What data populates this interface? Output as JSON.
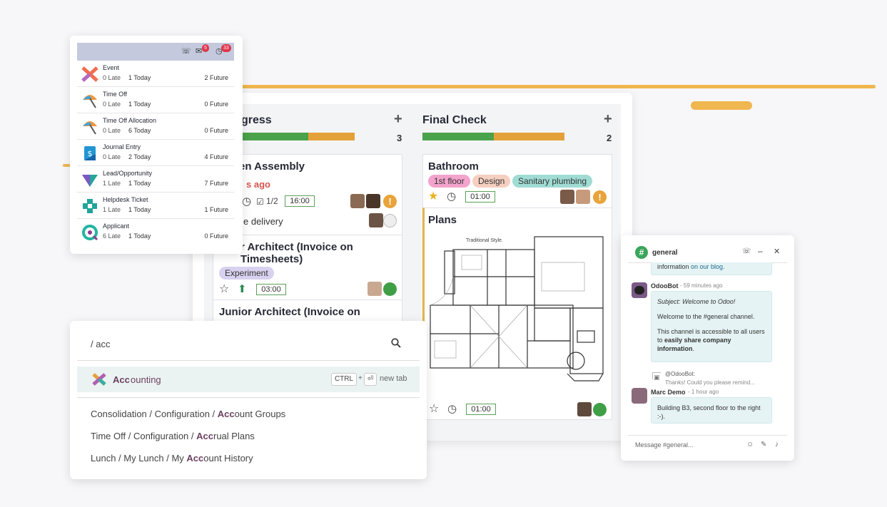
{
  "colors": {
    "accent": "#875a7b",
    "progress_green": "#4aa24a",
    "progress_orange": "#e4a13a",
    "stroke_orange": "#f0b64f",
    "chat_bubble": "#e5f3f4",
    "late_red": "#d9534f"
  },
  "kanban": {
    "columns": [
      {
        "title": "gress",
        "count": "3"
      },
      {
        "title": "Final Check",
        "count": "2"
      }
    ],
    "cards": [
      {
        "title": "en Assembly",
        "late_text": "s ago",
        "checklist": "1/2",
        "time": "16:00",
        "activity": "e delivery"
      },
      {
        "title": "r Architect (Invoice on Timesheets)",
        "tag": "Experiment",
        "time": "03:00"
      },
      {
        "title": "Junior Architect (Invoice on"
      },
      {
        "title": "Bathroom",
        "tags": [
          "1st floor",
          "Design",
          "Sanitary plumbing"
        ],
        "time": "01:00"
      },
      {
        "title": "Plans",
        "floorplan_caption": "Traditional Style.",
        "time": "01:00"
      }
    ]
  },
  "activity": {
    "badges": {
      "chat": "5",
      "clock": "33"
    },
    "items": [
      {
        "name": "Event",
        "late": "0 Late",
        "today": "1 Today",
        "future": "2 Future",
        "icon": "event-icon"
      },
      {
        "name": "Time Off",
        "late": "0 Late",
        "today": "1 Today",
        "future": "0 Future",
        "icon": "time-off-icon"
      },
      {
        "name": "Time Off Allocation",
        "late": "0 Late",
        "today": "6 Today",
        "future": "0 Future",
        "icon": "time-off-allocation-icon"
      },
      {
        "name": "Journal Entry",
        "late": "0 Late",
        "today": "2 Today",
        "future": "4 Future",
        "icon": "journal-entry-icon"
      },
      {
        "name": "Lead/Opportunity",
        "late": "1 Late",
        "today": "1 Today",
        "future": "7 Future",
        "icon": "lead-icon"
      },
      {
        "name": "Helpdesk Ticket",
        "late": "1 Late",
        "today": "1 Today",
        "future": "1 Future",
        "icon": "helpdesk-icon"
      },
      {
        "name": "Applicant",
        "late": "6 Late",
        "today": "1 Today",
        "future": "0 Future",
        "icon": "applicant-icon"
      }
    ]
  },
  "palette": {
    "query": "/ acc",
    "selected": {
      "match": "Acc",
      "rest": "ounting",
      "kbd_ctrl": "CTRL",
      "kbd_plus": "+",
      "kbd_enter": "⏎",
      "new_tab": "new tab"
    },
    "results": [
      {
        "pre": "Consolidation / Configuration / ",
        "match": "Acc",
        "post": "ount Groups"
      },
      {
        "pre": "Time Off / Configuration / ",
        "match": "Acc",
        "post": "rual Plans"
      },
      {
        "pre": "Lunch / My Lunch / My ",
        "match": "Acc",
        "post": "ount History"
      }
    ]
  },
  "chat": {
    "channel": "general",
    "prev_text": "information ",
    "prev_link": "on our blog.",
    "bot_name": "OdooBot",
    "bot_time": "- 59 minutes ago",
    "bot_subject": "Subject: Welcome to Odoo!",
    "bot_p1": "Welcome to the #general channel.",
    "bot_p2a": "This channel is accessible to all users to ",
    "bot_p2b": "easily share company information",
    "bot_p2c": ".",
    "reply_to": "@OdooBot:",
    "reply_snippet": "Thanks! Could you please remind...",
    "user_name": "Marc Demo",
    "user_time": "- 1 hour ago",
    "user_msg": "Building B3, second floor to the right :-).",
    "input_placeholder": "Message #general..."
  }
}
